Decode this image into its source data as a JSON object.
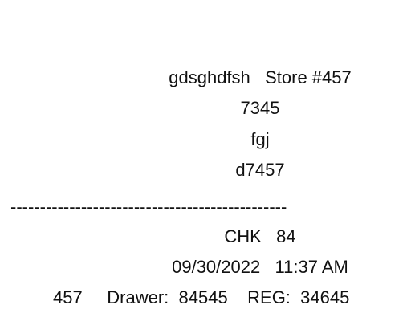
{
  "receipt": {
    "header": {
      "store_line": "gdsghdfsh   Store #457",
      "line2": "7345",
      "line3": "fgj",
      "line4": "d7457"
    },
    "divider": "-----------------------------------------------",
    "check_line": "CHK   84",
    "datetime_line": "09/30/2022   11:37 AM",
    "register_line": "457     Drawer:  84545    REG:  34645"
  }
}
